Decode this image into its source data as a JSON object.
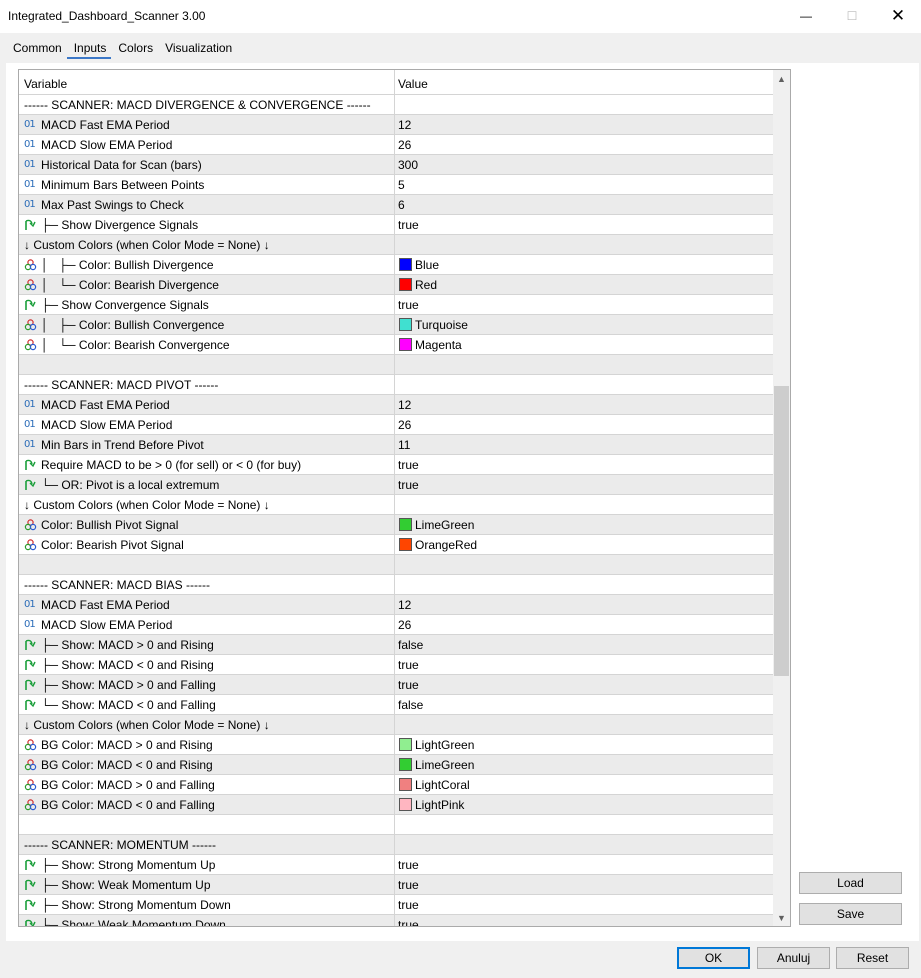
{
  "window": {
    "title": "Integrated_Dashboard_Scanner 3.00",
    "minimize": "—",
    "maximize": "☐",
    "close": "✕"
  },
  "tabs": [
    {
      "label": "Common",
      "active": false
    },
    {
      "label": "Inputs",
      "active": true
    },
    {
      "label": "Colors",
      "active": false
    },
    {
      "label": "Visualization",
      "active": false
    }
  ],
  "grid": {
    "headers": {
      "variable": "Variable",
      "value": "Value"
    },
    "rows": [
      {
        "type": "section",
        "name": "------ SCANNER: MACD DIVERGENCE & CONVERGENCE ------",
        "value": ""
      },
      {
        "type": "int",
        "name": "MACD Fast EMA Period",
        "value": "12"
      },
      {
        "type": "int",
        "name": "MACD Slow EMA Period",
        "value": "26"
      },
      {
        "type": "int",
        "name": "Historical Data for Scan (bars)",
        "value": "300"
      },
      {
        "type": "int",
        "name": "Minimum Bars Between Points",
        "value": "5"
      },
      {
        "type": "int",
        "name": "Max Past Swings to Check",
        "value": "6"
      },
      {
        "type": "bool",
        "name": "├─ Show Divergence Signals",
        "value": "true"
      },
      {
        "type": "section",
        "name": "↓ Custom Colors (when Color Mode = None) ↓",
        "value": ""
      },
      {
        "type": "color",
        "name": "│   ├─ Color: Bullish Divergence",
        "value": "Blue",
        "swatch": "#0000ff"
      },
      {
        "type": "color",
        "name": "│   └─ Color: Bearish Divergence",
        "value": "Red",
        "swatch": "#ff0000"
      },
      {
        "type": "bool",
        "name": "├─ Show Convergence Signals",
        "value": "true"
      },
      {
        "type": "color",
        "name": "│   ├─ Color: Bullish Convergence",
        "value": "Turquoise",
        "swatch": "#40e0d0"
      },
      {
        "type": "color",
        "name": "│   └─ Color: Bearish Convergence",
        "value": "Magenta",
        "swatch": "#ff00ff"
      },
      {
        "type": "section",
        "name": "",
        "value": ""
      },
      {
        "type": "section",
        "name": "------ SCANNER: MACD PIVOT ------",
        "value": ""
      },
      {
        "type": "int",
        "name": "MACD Fast EMA Period",
        "value": "12"
      },
      {
        "type": "int",
        "name": "MACD Slow EMA Period",
        "value": "26"
      },
      {
        "type": "int",
        "name": "Min Bars in Trend Before Pivot",
        "value": "11"
      },
      {
        "type": "bool",
        "name": "Require MACD to be > 0 (for sell) or < 0 (for buy)",
        "value": "true"
      },
      {
        "type": "bool",
        "name": "└─ OR: Pivot is a local extremum",
        "value": "true"
      },
      {
        "type": "section",
        "name": "↓ Custom Colors (when Color Mode = None) ↓",
        "value": ""
      },
      {
        "type": "color",
        "name": "Color: Bullish Pivot Signal",
        "value": "LimeGreen",
        "swatch": "#32cd32"
      },
      {
        "type": "color",
        "name": "Color: Bearish Pivot Signal",
        "value": "OrangeRed",
        "swatch": "#ff4500"
      },
      {
        "type": "section",
        "name": "",
        "value": ""
      },
      {
        "type": "section",
        "name": "------ SCANNER: MACD BIAS ------",
        "value": ""
      },
      {
        "type": "int",
        "name": "MACD Fast EMA Period",
        "value": "12"
      },
      {
        "type": "int",
        "name": "MACD Slow EMA Period",
        "value": "26"
      },
      {
        "type": "bool",
        "name": "├─ Show: MACD > 0 and Rising",
        "value": "false"
      },
      {
        "type": "bool",
        "name": "├─ Show: MACD < 0 and Rising",
        "value": "true"
      },
      {
        "type": "bool",
        "name": "├─ Show: MACD > 0 and Falling",
        "value": "true"
      },
      {
        "type": "bool",
        "name": "└─ Show: MACD < 0 and Falling",
        "value": "false"
      },
      {
        "type": "section",
        "name": "↓ Custom Colors (when Color Mode = None) ↓",
        "value": ""
      },
      {
        "type": "color",
        "name": "BG Color: MACD > 0 and Rising",
        "value": "LightGreen",
        "swatch": "#90ee90"
      },
      {
        "type": "color",
        "name": "BG Color: MACD < 0 and Rising",
        "value": "LimeGreen",
        "swatch": "#32cd32"
      },
      {
        "type": "color",
        "name": "BG Color: MACD > 0 and Falling",
        "value": "LightCoral",
        "swatch": "#f08080"
      },
      {
        "type": "color",
        "name": "BG Color: MACD < 0 and Falling",
        "value": "LightPink",
        "swatch": "#ffb6c1"
      },
      {
        "type": "section",
        "name": "",
        "value": ""
      },
      {
        "type": "section",
        "name": "------ SCANNER: MOMENTUM ------",
        "value": ""
      },
      {
        "type": "bool",
        "name": "├─ Show: Strong Momentum Up",
        "value": "true"
      },
      {
        "type": "bool",
        "name": "├─ Show: Weak Momentum Up",
        "value": "true"
      },
      {
        "type": "bool",
        "name": "├─ Show: Strong Momentum Down",
        "value": "true"
      },
      {
        "type": "bool",
        "name": "├─ Show: Weak Momentum Down",
        "value": "true"
      }
    ]
  },
  "icons": {
    "int": "01",
    "bool": "bool-icon",
    "color": "palette-icon",
    "scroll_up": "▲",
    "scroll_down": "▼"
  },
  "side_buttons": {
    "load": "Load",
    "save": "Save"
  },
  "footer": {
    "ok": "OK",
    "cancel": "Anuluj",
    "reset": "Reset"
  }
}
